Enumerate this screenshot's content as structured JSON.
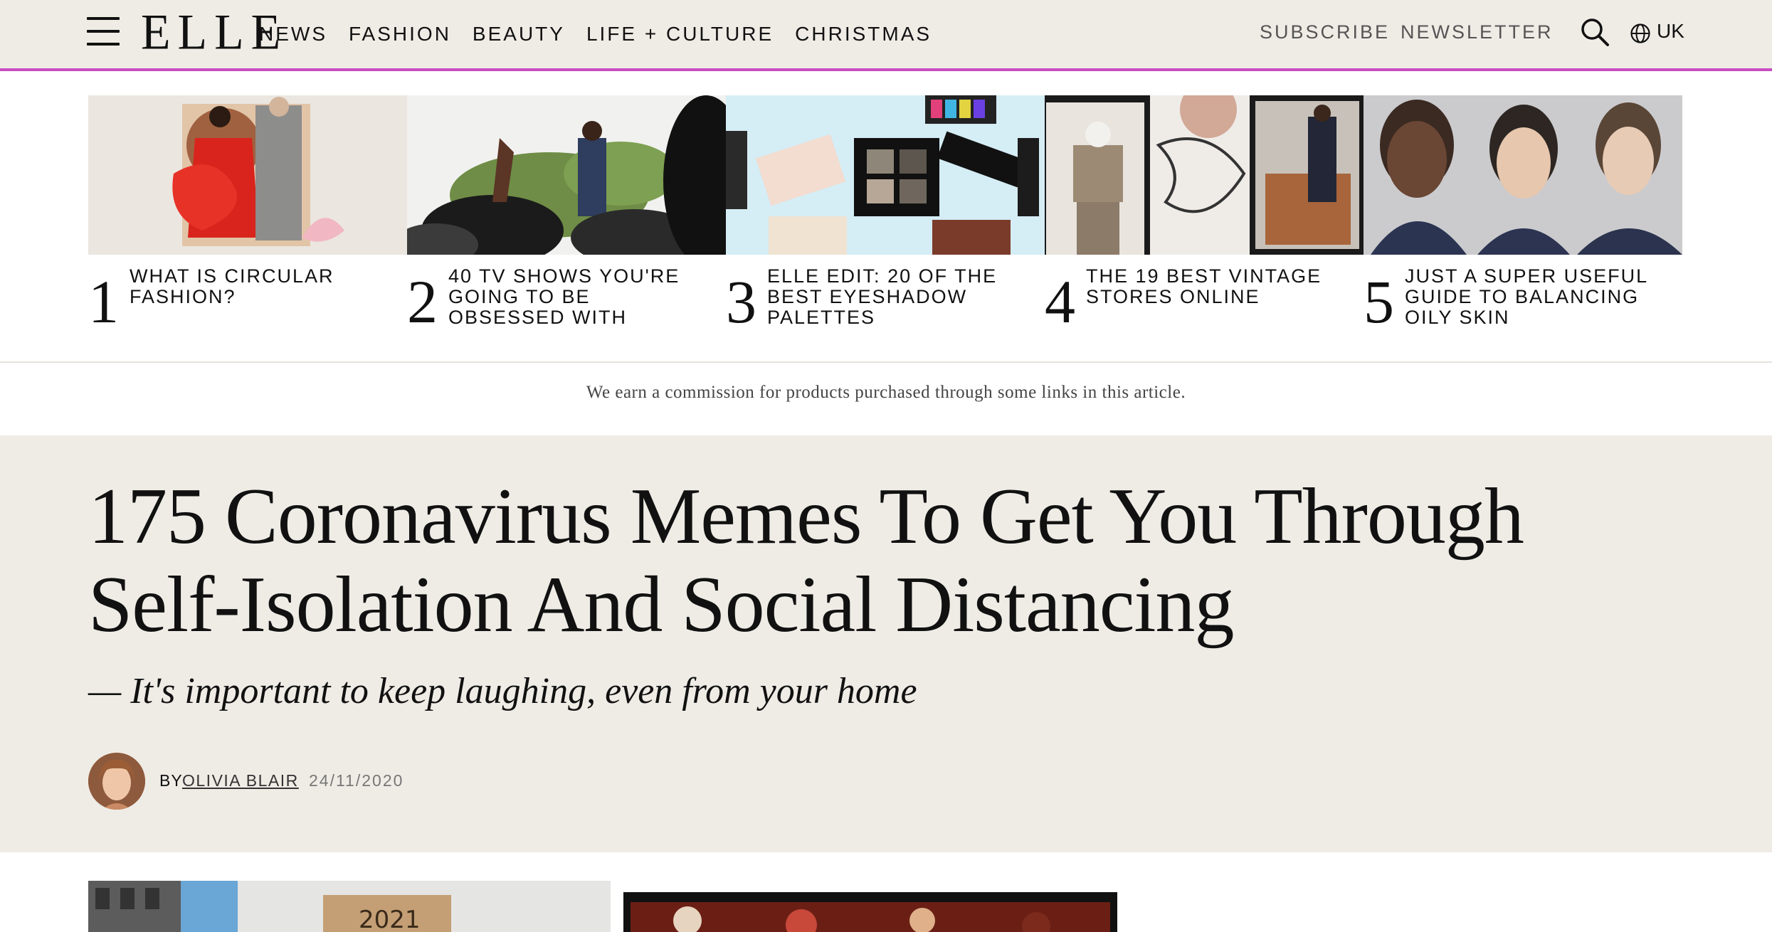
{
  "header": {
    "logo": "ELLE",
    "nav": [
      "NEWS",
      "FASHION",
      "BEAUTY",
      "LIFE + CULTURE",
      "CHRISTMAS"
    ],
    "subscribe": "SUBSCRIBE",
    "newsletter": "NEWSLETTER",
    "region": "UK",
    "accent_color": "#c94cc0"
  },
  "trending": [
    {
      "num": "1",
      "title": "WHAT IS CIRCULAR FASHION?"
    },
    {
      "num": "2",
      "title": "40 TV SHOWS YOU'RE GOING TO BE OBSESSED WITH"
    },
    {
      "num": "3",
      "title": "ELLE EDIT: 20 OF THE BEST EYESHADOW PALETTES"
    },
    {
      "num": "4",
      "title": "THE 19 BEST VINTAGE STORES ONLINE"
    },
    {
      "num": "5",
      "title": "JUST A SUPER USEFUL GUIDE TO BALANCING OILY SKIN"
    }
  ],
  "commission": "We earn a commission for products purchased through some links in this article.",
  "article": {
    "headline": "175 Coronavirus Memes To Get You Through Self-Isolation And Social Distancing",
    "dek": "— It's important to keep laughing, even from your home",
    "by_label": "BY",
    "author": "OLIVIA BLAIR",
    "date": "24/11/2020"
  },
  "colors": {
    "header_bg": "#efece6",
    "hero_bg": "#efece6"
  }
}
